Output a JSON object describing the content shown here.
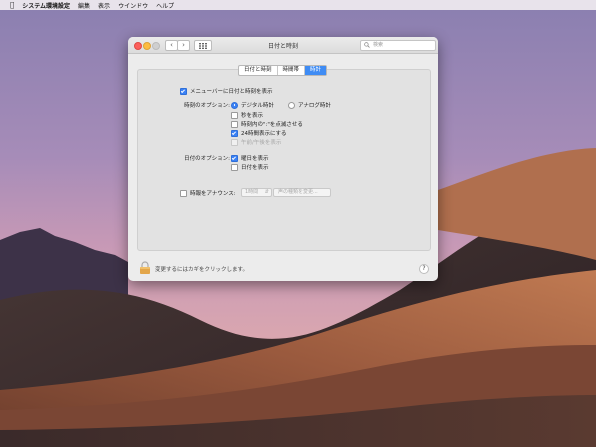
{
  "menubar": {
    "app_name": "システム環境設定",
    "items": [
      "編集",
      "表示",
      "ウインドウ",
      "ヘルプ"
    ]
  },
  "window": {
    "title": "日付と時刻",
    "search_placeholder": "検索"
  },
  "tabs": [
    {
      "label": "日付と時刻",
      "active": false
    },
    {
      "label": "時間帯",
      "active": false
    },
    {
      "label": "時計",
      "active": true
    }
  ],
  "clock": {
    "show_in_menubar": {
      "label": "メニューバーに日付と時刻を表示",
      "checked": true
    },
    "time_options_label": "時刻のオプション:",
    "digital": {
      "label": "デジタル時計",
      "selected": true
    },
    "analog": {
      "label": "アナログ時計",
      "selected": false
    },
    "show_seconds": {
      "label": "秒を表示",
      "checked": false
    },
    "flash_separators": {
      "label": "時刻内の\":\"を点滅させる",
      "checked": false
    },
    "use_24h": {
      "label": "24時間表示にする",
      "checked": true
    },
    "show_ampm": {
      "label": "午前/午後を表示",
      "checked": false,
      "enabled": false
    },
    "date_options_label": "日付のオプション:",
    "show_weekday": {
      "label": "曜日を表示",
      "checked": true
    },
    "show_date": {
      "label": "日付を表示",
      "checked": false
    },
    "announce": {
      "label": "時報をアナウンス:",
      "checked": false
    },
    "announce_interval": "1時間",
    "customize_voice": "声の種類を変更..."
  },
  "footer": {
    "lock_text": "変更するにはカギをクリックします。",
    "help": "?"
  },
  "colors": {
    "accent": "#3b82f6"
  }
}
